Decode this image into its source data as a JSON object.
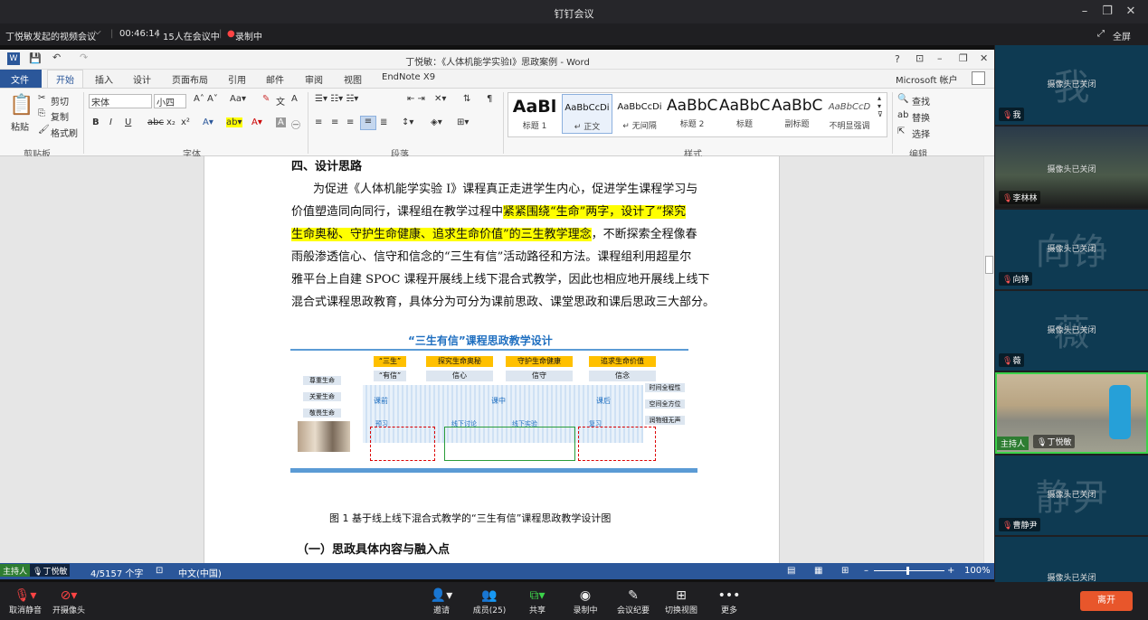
{
  "window": {
    "title": "钉钉会议"
  },
  "info": {
    "meeting": "丁悦敏发起的视频会议",
    "duration": "00:46:14",
    "participants": "15人在会议中",
    "recording": "录制中",
    "fullscreen": "全屏"
  },
  "word": {
    "title": "丁悦敏：《人体机能学实验I》思政案例 - Word",
    "account": "Microsoft 帐户",
    "tabs": [
      "文件",
      "开始",
      "插入",
      "设计",
      "页面布局",
      "引用",
      "邮件",
      "审阅",
      "视图",
      "EndNote X9"
    ],
    "clipboard": {
      "paste": "粘贴",
      "cut": "剪切",
      "copy": "复制",
      "format": "格式刷",
      "group": "剪贴板"
    },
    "font": {
      "name": "宋体",
      "size": "小四",
      "group": "字体"
    },
    "paragraph_group": "段落",
    "styles": [
      {
        "preview": "AaBl",
        "name": "标题 1"
      },
      {
        "preview": "AaBbCcDi",
        "name": "↵ 正文"
      },
      {
        "preview": "AaBbCcDi",
        "name": "↵ 无间隔"
      },
      {
        "preview": "AaBbC",
        "name": "标题 2"
      },
      {
        "preview": "AaBbC",
        "name": "标题"
      },
      {
        "preview": "AaBbC",
        "name": "副标题"
      },
      {
        "preview": "AaBbCcD",
        "name": "不明显强调"
      }
    ],
    "styles_group": "样式",
    "edit": {
      "find": "查找",
      "replace": "替换",
      "select": "选择",
      "group": "编辑"
    },
    "doc": {
      "heading": "四、设计思路",
      "lines": [
        "为促进《人体机能学实验 I》课程真正走进学生内心，促进学生课程学习与",
        "价值塑造同向同行，课程组在教学过程中紧紧围绕“生命”两字，设计了“探究",
        "生命奥秘、守护生命健康、追求生命价值”的三生教学理念，不断探索全程像春",
        "雨般渗透信心、信守和信念的“三生有信”活动路径和方法。课程组利用超星尔",
        "雅平台上自建 SPOC 课程开展线上线下混合式教学，因此也相应地开展线上线下",
        "混合式课程思政教育，具体分为可分为课前思政、课堂思政和课后思政三大部分。"
      ],
      "figure_title": "“三生有信”课程思政教学设计",
      "figure_row1": [
        "“三生”",
        "探究生命奥秘",
        "守护生命健康",
        "追求生命价值"
      ],
      "figure_row2": [
        "“有信”",
        "信心",
        "信守",
        "信念"
      ],
      "figure_left": [
        "尊重生命",
        "关爱生命",
        "敬畏生命"
      ],
      "figure_right": [
        "时间全程性",
        "空间全方位",
        "润物细无声"
      ],
      "figure_stages": [
        "课前",
        "课中",
        "课后"
      ],
      "figure_sub": [
        "预习",
        "线下讨论",
        "线下实验",
        "复习"
      ],
      "figure_caption": "图 1  基于线上线下混合式教学的“三生有信”课程思政教学设计图",
      "subheading": "（一）思政具体内容与融入点"
    },
    "status": {
      "words": "4/5157 个字",
      "lang": "中文(中国)",
      "zoom": "100%"
    }
  },
  "participants": [
    {
      "avatar_char": "我",
      "name": "我",
      "camera": "摄像头已关闭"
    },
    {
      "avatar_char": "",
      "name": "李林林",
      "camera": "摄像头已关闭"
    },
    {
      "avatar_char": "向铮",
      "name": "向铮",
      "camera": "摄像头已关闭"
    },
    {
      "avatar_char": "薇",
      "name": "薇",
      "camera": "摄像头已关闭"
    },
    {
      "avatar_char": "",
      "name": "丁悦敏",
      "role": "主持人",
      "camera": ""
    },
    {
      "avatar_char": "静尹",
      "name": "曹静尹",
      "camera": "摄像头已关闭"
    },
    {
      "avatar_char": "",
      "name": "",
      "camera": "摄像头已关闭"
    }
  ],
  "host_tag": {
    "role": "主持人",
    "name": "丁悦敏"
  },
  "toolbar": {
    "mute": "取消静音",
    "camera": "开摄像头",
    "invite": "邀请",
    "members": "成员(25)",
    "share": "共享",
    "record": "录制中",
    "minutes": "会议纪要",
    "layout": "切换视图",
    "more": "更多",
    "leave": "离开"
  }
}
